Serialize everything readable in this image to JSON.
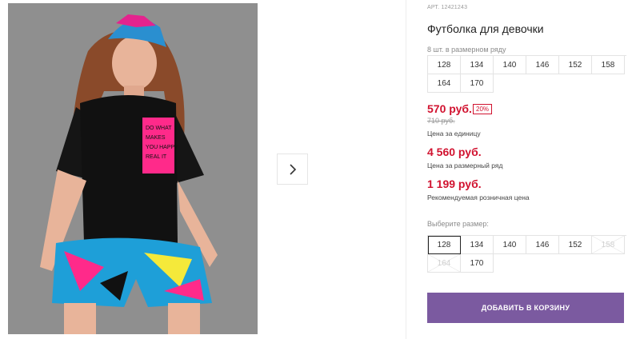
{
  "product": {
    "article_label": "АРТ.",
    "article_number": "12421243",
    "title": "Футболка для девочки",
    "pack_note": "8 шт. в размерном ряду",
    "pack_sizes": [
      "128",
      "134",
      "140",
      "146",
      "152",
      "158",
      "164",
      "170"
    ],
    "price": "570 руб.",
    "discount": "20%",
    "old_price": "710 руб.",
    "price_unit_label": "Цена за единицу",
    "price_set": "4 560 руб.",
    "price_set_label": "Цена за размерный ряд",
    "price_rrp": "1 199 руб.",
    "price_rrp_label": "Рекомендуемая розничная цена",
    "choose_size_label": "Выберите размер:",
    "size_options": [
      {
        "label": "128",
        "state": "selected"
      },
      {
        "label": "134",
        "state": "available"
      },
      {
        "label": "140",
        "state": "available"
      },
      {
        "label": "146",
        "state": "available"
      },
      {
        "label": "152",
        "state": "available"
      },
      {
        "label": "158",
        "state": "disabled"
      },
      {
        "label": "164",
        "state": "disabled"
      },
      {
        "label": "170",
        "state": "available"
      }
    ],
    "add_to_cart": "ДОБАВИТЬ В КОРЗИНУ"
  },
  "gallery": {
    "next_icon": "chevron-right-icon",
    "pocket_text": [
      "DO WHAT",
      "MAKES",
      "YOU HAPPY",
      "REAL IT"
    ]
  },
  "colors": {
    "price_red": "#d1122f",
    "button_purple": "#7b5aa0"
  }
}
